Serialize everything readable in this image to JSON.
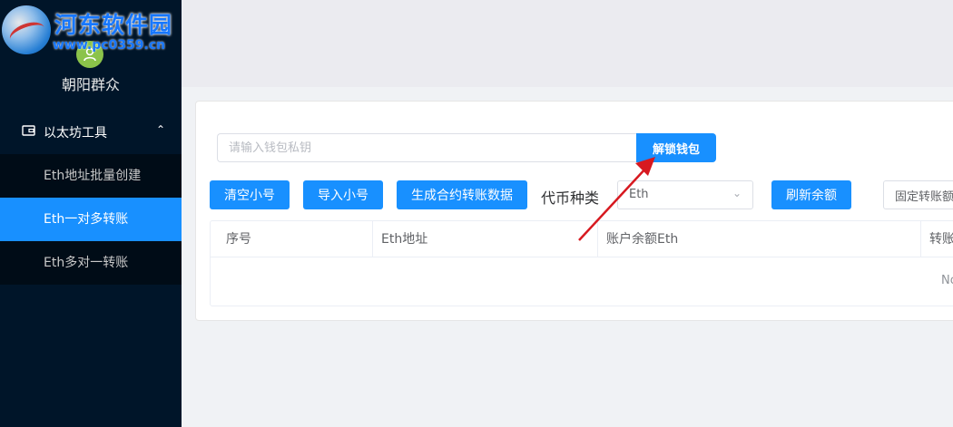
{
  "watermark": {
    "title": "河东软件园",
    "url": "www.pc0359.cn"
  },
  "user": {
    "name": "朝阳群众",
    "avatar_icon": "user-icon"
  },
  "sidebar": {
    "group": {
      "label": "以太坊工具",
      "icon": "wallet-icon",
      "expanded": true
    },
    "items": [
      {
        "label": "Eth地址批量创建",
        "active": false
      },
      {
        "label": "Eth一对多转账",
        "active": true
      },
      {
        "label": "Eth多对一转账",
        "active": false
      }
    ]
  },
  "wallet": {
    "placeholder": "请输入钱包私钥",
    "value": "",
    "unlock_label": "解锁钱包"
  },
  "toolbar": {
    "clear_label": "清空小号",
    "import_label": "导入小号",
    "generate_label": "生成合约转账数据",
    "token_label": "代币种类",
    "token_value": "Eth",
    "refresh_label": "刷新余额",
    "fixed_label": "固定转账额"
  },
  "table": {
    "columns": [
      "序号",
      "Eth地址",
      "账户余额Eth",
      "转账"
    ],
    "rows": [],
    "empty_text": "No"
  },
  "colors": {
    "primary": "#1890ff",
    "sidebar_bg": "#001529",
    "submenu_bg": "#000c17",
    "annotation_arrow": "#d71920"
  }
}
